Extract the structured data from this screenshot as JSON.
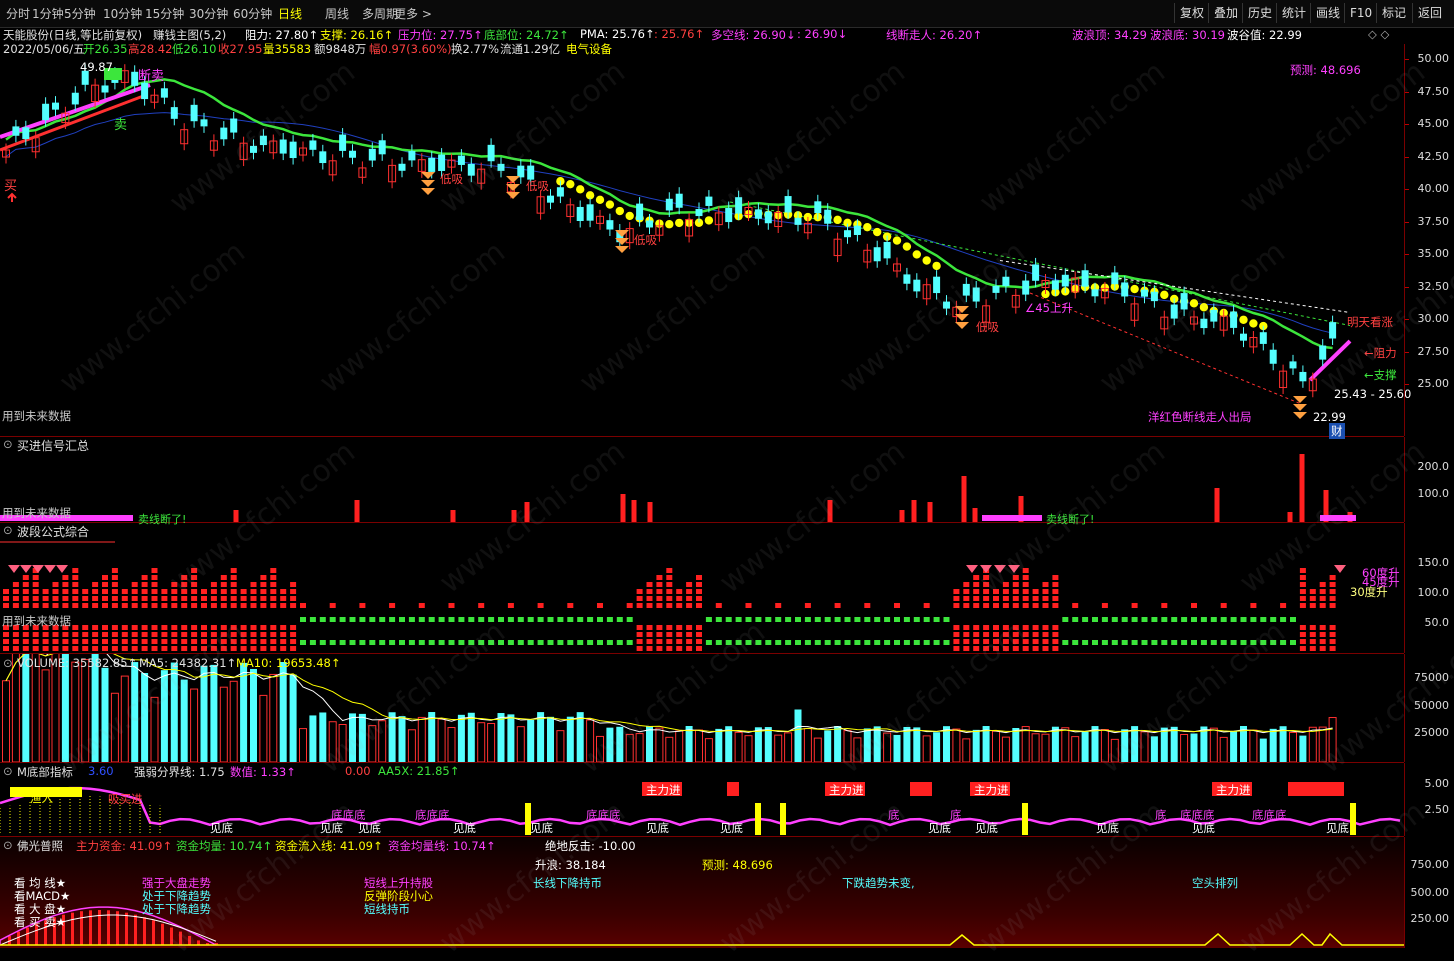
{
  "toolbar": {
    "periods": [
      "分时",
      "1分钟",
      "5分钟",
      "10分钟",
      "15分钟",
      "30分钟",
      "60分钟",
      "日线",
      "周线",
      "多周期",
      "更多 >"
    ],
    "active_period": "日线",
    "right_buttons": [
      "复权",
      "叠加",
      "历史",
      "统计",
      "画线",
      "F10",
      "标记",
      "返回"
    ]
  },
  "header": {
    "stock": "天能股份(日线,等比前复权)",
    "indicator": "赚钱主图(5,2)",
    "resistance": "阻力: 27.80↑",
    "support": "支撑: 26.16↑",
    "pressure": "压力位: 27.75↑",
    "bottom": "底部位: 24.72↑",
    "pma": "PMA: 25.76↑",
    "pma2": ": 25.76↑",
    "duokong": "多空线: 26.90↓",
    "duokong2": ": 26.90↓",
    "xianduan": "线断走人: 26.20↑",
    "wave_top": "波浪顶: 34.29",
    "wave_bottom": "波浪底: 30.19",
    "valley": "波谷值: 22.99"
  },
  "quote": {
    "date": "2022/05/06/五",
    "open": "开26.35",
    "high": "高28.42",
    "low": "低26.10",
    "close": "收27.95",
    "volume": "量35583",
    "amount": "额9848万",
    "change": "幅0.97(3.60%)",
    "turnover": "换2.77%",
    "float": "流通1.29亿",
    "sector": "电气设备"
  },
  "main_labels": {
    "high_mark": "49.87",
    "duanmai": "断卖",
    "mai": "卖",
    "buy": "买",
    "dixi": "低吸",
    "forecast": "预测: 48.696",
    "future_data": "用到未来数据",
    "mingtian": "明天看涨",
    "zuli": "←阻力",
    "zhicheng": "←支撑",
    "range": "25.43 - 25.60",
    "break_line": "洋红色断线走人出局",
    "low_mark": "22.99",
    "cai": "财",
    "angle": "∠45上升"
  },
  "price_axis": [
    "50.00",
    "47.50",
    "45.00",
    "42.50",
    "40.00",
    "37.50",
    "35.00",
    "32.50",
    "30.00",
    "27.50",
    "25.00"
  ],
  "pane_buy": {
    "title": "买进信号汇总",
    "axis": [
      "200.0",
      "100.0"
    ],
    "sell_label": "卖线断了!",
    "future": "用到未来数据"
  },
  "pane_wave": {
    "title": "波段公式综合",
    "axis": [
      "150.0",
      "100.0",
      "50.0"
    ],
    "deg60": "60度升",
    "deg45": "45度升",
    "deg30": "30度升",
    "future": "用到未来数据"
  },
  "pane_volume": {
    "title": "VOLUME: 35582.85↑",
    "ma5": "MA5: 24382.31↑",
    "ma10": "MA10: 19653.48↑",
    "axis": [
      "75000",
      "50000",
      "25000"
    ]
  },
  "pane_m": {
    "title": "M底部指标",
    "v1": "3.60",
    "strong": "强弱分界线: 1.75",
    "value": "数值: 1.33↑",
    "v2": "0.00",
    "aa5x": "AA5X: 21.85↑",
    "axis": [
      "5.00",
      "2.50"
    ],
    "zhulijin": "主力进",
    "jiandi": "见底",
    "di": "底",
    "didi": "底底底",
    "fuyu": "渔入",
    "linghao": "吸买进"
  },
  "pane_fo": {
    "title": "佛光普照",
    "zhuli": "主力资金: 41.09↑",
    "junliang": "资金均量: 10.74↑",
    "liuru": "资金流入线: 41.09↑",
    "junliangxian": "资金均量线: 10.74↑",
    "fanji": "绝地反击: -10.00",
    "shenglang": "升浪: 38.184",
    "yuce": "预测: 48.696",
    "kan": [
      "看 均 线★",
      "看MACD★",
      "看 大 盘★",
      "看 买 卖★"
    ],
    "col1": [
      "强于大盘走势",
      "处于下降趋势",
      "处于下降趋势"
    ],
    "col2": [
      "短线上升持股",
      "反弹阶段小心",
      "短线持币"
    ],
    "col3": "长线下降持币",
    "col4": "下跌趋势未变,",
    "col5": "空头排列",
    "axis": [
      "750.00",
      "500.00",
      "250.00"
    ]
  },
  "colors": {
    "up": "#ff3030",
    "down": "#54ffff",
    "accent": "#ff40ff",
    "yellow": "#ffff00",
    "green": "#3ce63c"
  }
}
